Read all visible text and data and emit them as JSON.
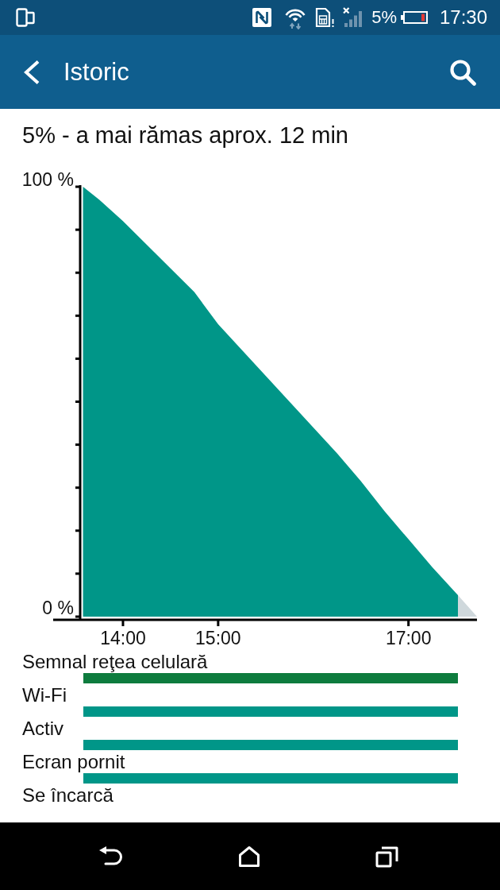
{
  "status_bar": {
    "battery": "5%",
    "time": "17:30"
  },
  "app_bar": {
    "title": "Istoric"
  },
  "summary": "5% - a mai rămas aprox. 12 min",
  "battery_chart": {
    "chart_data": {
      "type": "area",
      "x": [
        13.58,
        13.75,
        14,
        14.25,
        14.5,
        14.75,
        15,
        15.25,
        15.5,
        15.75,
        16,
        16.25,
        16.5,
        16.75,
        17,
        17.25,
        17.52,
        17.72
      ],
      "series": [
        {
          "color": "#009688",
          "values": [
            100,
            97,
            92,
            86.5,
            81,
            75.5,
            68,
            62,
            56,
            50,
            44,
            38,
            31.5,
            24.5,
            18,
            11.5,
            5,
            null
          ]
        },
        {
          "color": "#cfd8dc",
          "values": [
            null,
            null,
            null,
            null,
            null,
            null,
            null,
            null,
            null,
            null,
            null,
            null,
            null,
            null,
            null,
            null,
            5,
            0
          ]
        }
      ],
      "xlim": [
        13.55,
        17.72
      ],
      "ylim": [
        0,
        100
      ],
      "xticks": [
        {
          "value": 14,
          "label": "14:00"
        },
        {
          "value": 15,
          "label": "15:00"
        },
        {
          "value": 17,
          "label": "17:00"
        }
      ],
      "yticks": [
        {
          "value": 0,
          "label": "0 %"
        },
        {
          "value": 100,
          "label": "100 %"
        }
      ]
    }
  },
  "activity_rows": [
    {
      "label": "Semnal reţea celulară",
      "on": true,
      "color": "#0e7c3e"
    },
    {
      "label": "Wi-Fi",
      "on": true,
      "color": "#009688"
    },
    {
      "label": "Activ",
      "on": true,
      "color": "#009688"
    },
    {
      "label": "Ecran pornit",
      "on": true,
      "color": "#009688"
    },
    {
      "label": "Se încarcă",
      "on": false
    }
  ]
}
